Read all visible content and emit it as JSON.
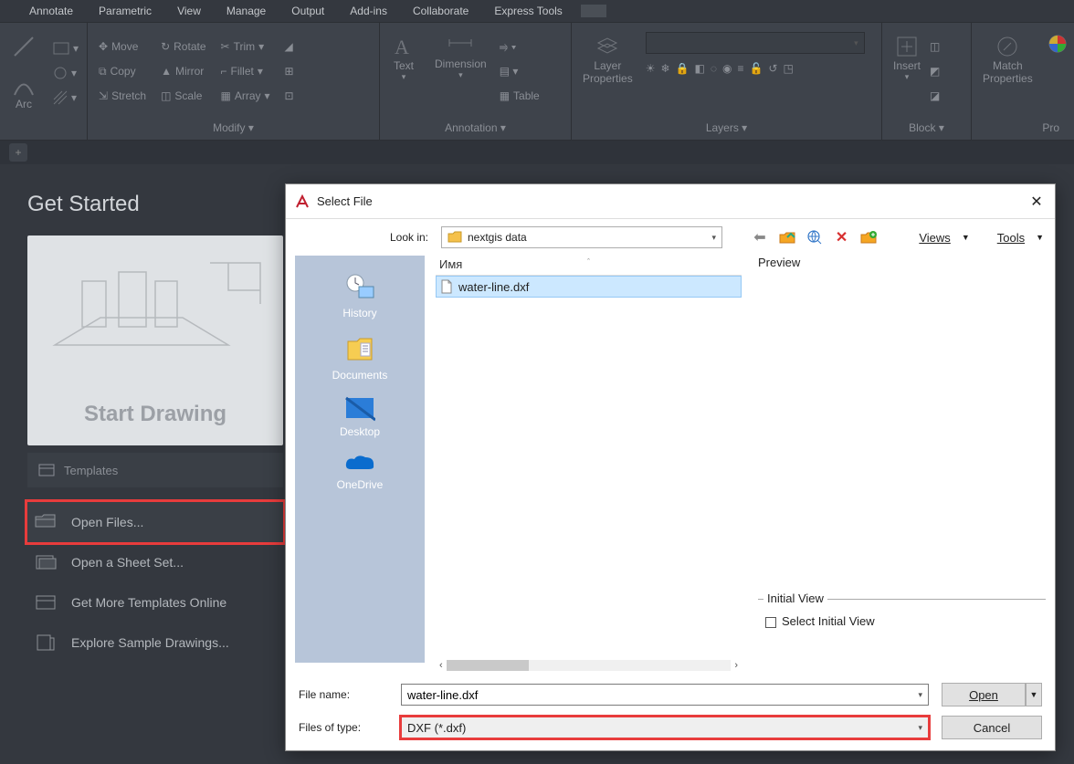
{
  "menubar": [
    "Annotate",
    "Parametric",
    "View",
    "Manage",
    "Output",
    "Add-ins",
    "Collaborate",
    "Express Tools"
  ],
  "ribbon": {
    "draw": {
      "arc_label": "Arc"
    },
    "modify": {
      "label": "Modify ▾",
      "move": "Move",
      "copy": "Copy",
      "stretch": "Stretch",
      "rotate": "Rotate",
      "mirror": "Mirror",
      "scale": "Scale",
      "trim": "Trim",
      "fillet": "Fillet",
      "array": "Array"
    },
    "annotation": {
      "label": "Annotation ▾",
      "text": "Text",
      "dimension": "Dimension",
      "table": "Table"
    },
    "layers": {
      "label": "Layers ▾",
      "layer_properties": "Layer\nProperties"
    },
    "block": {
      "label": "Block ▾",
      "insert": "Insert"
    },
    "props": {
      "label": "Pro",
      "match": "Match\nProperties"
    }
  },
  "start": {
    "title": "Get Started",
    "draw_label": "Start Drawing",
    "templates": "Templates",
    "open_files": "Open Files...",
    "open_sheetset": "Open a Sheet Set...",
    "get_templates": "Get More Templates Online",
    "explore_samples": "Explore Sample Drawings..."
  },
  "dialog": {
    "title": "Select File",
    "look_in_label": "Look in:",
    "look_in_folder": "nextgis data",
    "views_label": "Views",
    "tools_label": "Tools",
    "places": [
      {
        "label": "History",
        "type": "history"
      },
      {
        "label": "Documents",
        "type": "documents"
      },
      {
        "label": "Desktop",
        "type": "desktop"
      },
      {
        "label": "OneDrive",
        "type": "onedrive"
      }
    ],
    "list_header_name": "Имя",
    "selected_file": "water-line.dxf",
    "preview_label": "Preview",
    "initial_view_label": "Initial View",
    "select_initial_view": "Select Initial View",
    "file_name_label": "File name:",
    "file_name_value": "water-line.dxf",
    "file_type_label": "Files of type:",
    "file_type_value": "DXF (*.dxf)",
    "open_btn": "Open",
    "cancel_btn": "Cancel"
  }
}
